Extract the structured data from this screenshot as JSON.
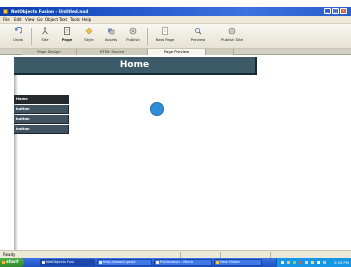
{
  "window": {
    "title": "NetObjects Fusion - Untitled.nod",
    "minimize_glyph": "_",
    "maximize_glyph": "□",
    "close_glyph": "×"
  },
  "menu": [
    "File",
    "Edit",
    "View",
    "Go",
    "Object",
    "Text",
    "Tools",
    "Help"
  ],
  "toolbar": {
    "buttons": [
      {
        "label": "Undo",
        "icon": "undo-icon"
      },
      {
        "label": "Site",
        "icon": "site-icon"
      },
      {
        "label": "Page",
        "icon": "page-icon"
      },
      {
        "label": "Style",
        "icon": "style-icon"
      },
      {
        "label": "Assets",
        "icon": "assets-icon"
      },
      {
        "label": "Publish",
        "icon": "publish-icon"
      },
      {
        "label": "New Page",
        "icon": "new-page-icon"
      },
      {
        "label": "Preview",
        "icon": "preview-icon"
      },
      {
        "label": "Publish Site",
        "icon": "publish-site-icon"
      }
    ]
  },
  "tabs": [
    "Page Design",
    "HTML Source",
    "Page Preview",
    ""
  ],
  "page": {
    "header_title": "Home",
    "nav": [
      "Home",
      "button",
      "button",
      "button"
    ]
  },
  "status": {
    "text": "Ready"
  },
  "taskbar": {
    "start_label": "start",
    "tasks": [
      "NetObjects Fusi",
      "http://www2.geoX",
      "Publication - Micro",
      "New Folder"
    ],
    "clock": "3:34 PM"
  },
  "colors": {
    "header_bg": "#3d5a68",
    "nav_bg": "#40525f",
    "nav_active_bg": "#272a2c",
    "dot": "#2e8fd8",
    "titlebar": "#0a3fb0"
  }
}
